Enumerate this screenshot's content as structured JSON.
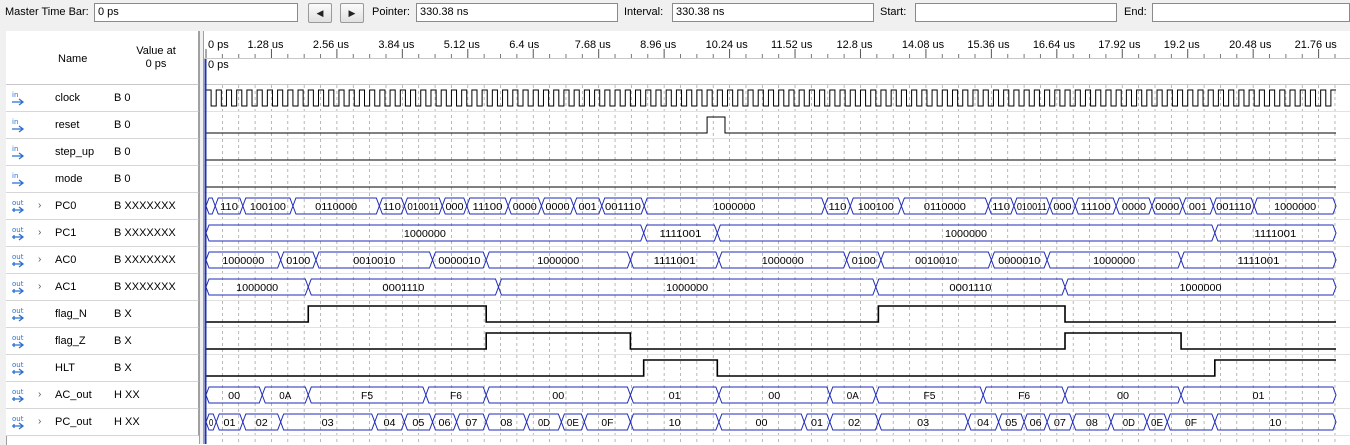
{
  "toolbar": {
    "master_label": "Master Time Bar:",
    "master_value": "0 ps",
    "pointer_label": "Pointer:",
    "pointer_value": "330.38 ns",
    "interval_label": "Interval:",
    "interval_value": "330.38 ns",
    "start_label": "Start:",
    "start_value": "",
    "end_label": "End:",
    "end_value": "",
    "prev_icon": "triangle-left-icon",
    "next_icon": "triangle-right-icon"
  },
  "header": {
    "name_label": "Name",
    "value_label_1": "Value at",
    "value_label_2": "0 ps"
  },
  "ruler": {
    "ticks": [
      "0 ps",
      "1.28 us",
      "2.56 us",
      "3.84 us",
      "5.12 us",
      "6.4 us",
      "7.68 us",
      "8.96 us",
      "10.24 us",
      "11.52 us",
      "12.8 us",
      "14.08 us",
      "15.36 us",
      "16.64 us",
      "17.92 us",
      "19.2 us",
      "20.48 us",
      "21.76 us"
    ],
    "cursor_label": "0 ps"
  },
  "signals": [
    {
      "name": "clock",
      "value": "B 0",
      "kind": "in",
      "expandable": false
    },
    {
      "name": "reset",
      "value": "B 0",
      "kind": "in",
      "expandable": false
    },
    {
      "name": "step_up",
      "value": "B 0",
      "kind": "in",
      "expandable": false
    },
    {
      "name": "mode",
      "value": "B 0",
      "kind": "in",
      "expandable": false
    },
    {
      "name": "PC0",
      "value": "B XXXXXXX",
      "kind": "out",
      "expandable": true
    },
    {
      "name": "PC1",
      "value": "B XXXXXXX",
      "kind": "out",
      "expandable": true
    },
    {
      "name": "AC0",
      "value": "B XXXXXXX",
      "kind": "out",
      "expandable": true
    },
    {
      "name": "AC1",
      "value": "B XXXXXXX",
      "kind": "out",
      "expandable": true
    },
    {
      "name": "flag_N",
      "value": "B X",
      "kind": "out",
      "expandable": false
    },
    {
      "name": "flag_Z",
      "value": "B X",
      "kind": "out",
      "expandable": false
    },
    {
      "name": "HLT",
      "value": "B X",
      "kind": "out",
      "expandable": false
    },
    {
      "name": "AC_out",
      "value": "H XX",
      "kind": "out",
      "expandable": true
    },
    {
      "name": "PC_out",
      "value": "H XX",
      "kind": "out",
      "expandable": true
    }
  ],
  "waveforms": {
    "time_range_us": [
      0,
      22.1
    ],
    "clock_period_us": 0.2,
    "reset_pulse_us": [
      9.8,
      10.15
    ],
    "PC0": {
      "segments": [
        {
          "t0": 0.0,
          "t1": 0.18,
          "label": ""
        },
        {
          "t0": 0.18,
          "t1": 0.72,
          "label": "110"
        },
        {
          "t0": 0.72,
          "t1": 1.7,
          "label": "100100"
        },
        {
          "t0": 1.7,
          "t1": 3.39,
          "label": "0110000"
        },
        {
          "t0": 3.39,
          "t1": 3.88,
          "label": "110"
        },
        {
          "t0": 3.88,
          "t1": 4.62,
          "label": "010011"
        },
        {
          "t0": 4.62,
          "t1": 5.1,
          "label": "000"
        },
        {
          "t0": 5.1,
          "t1": 5.91,
          "label": "11100"
        },
        {
          "t0": 5.91,
          "t1": 6.56,
          "label": "0000"
        },
        {
          "t0": 6.56,
          "t1": 7.19,
          "label": "0000"
        },
        {
          "t0": 7.19,
          "t1": 7.74,
          "label": "001"
        },
        {
          "t0": 7.74,
          "t1": 8.57,
          "label": "001110"
        },
        {
          "t0": 8.57,
          "t1": 12.1,
          "label": "1000000"
        },
        {
          "t0": 12.1,
          "t1": 12.6,
          "label": "110"
        },
        {
          "t0": 12.6,
          "t1": 13.6,
          "label": "100100"
        },
        {
          "t0": 13.6,
          "t1": 15.3,
          "label": "0110000"
        },
        {
          "t0": 15.3,
          "t1": 15.8,
          "label": "110"
        },
        {
          "t0": 15.8,
          "t1": 16.5,
          "label": "010011"
        },
        {
          "t0": 16.5,
          "t1": 17.0,
          "label": "000"
        },
        {
          "t0": 17.0,
          "t1": 17.8,
          "label": "11100"
        },
        {
          "t0": 17.8,
          "t1": 18.5,
          "label": "0000"
        },
        {
          "t0": 18.5,
          "t1": 19.1,
          "label": "0000"
        },
        {
          "t0": 19.1,
          "t1": 19.7,
          "label": "001"
        },
        {
          "t0": 19.7,
          "t1": 20.5,
          "label": "001110"
        },
        {
          "t0": 20.5,
          "t1": 22.1,
          "label": "1000000"
        }
      ]
    },
    "PC1": {
      "segments": [
        {
          "t0": 0.0,
          "t1": 8.56,
          "label": "1000000"
        },
        {
          "t0": 8.56,
          "t1": 10.0,
          "label": "1111001"
        },
        {
          "t0": 10.0,
          "t1": 19.73,
          "label": "1000000"
        },
        {
          "t0": 19.73,
          "t1": 22.1,
          "label": "1111001"
        }
      ]
    },
    "AC0": {
      "segments": [
        {
          "t0": 0.0,
          "t1": 1.46,
          "label": "1000000"
        },
        {
          "t0": 1.46,
          "t1": 2.15,
          "label": "0100"
        },
        {
          "t0": 2.15,
          "t1": 4.43,
          "label": "0010010"
        },
        {
          "t0": 4.43,
          "t1": 5.48,
          "label": "0000010"
        },
        {
          "t0": 5.48,
          "t1": 8.3,
          "label": "1000000"
        },
        {
          "t0": 8.3,
          "t1": 10.03,
          "label": "1111001"
        },
        {
          "t0": 10.03,
          "t1": 12.53,
          "label": "1000000"
        },
        {
          "t0": 12.53,
          "t1": 13.2,
          "label": "0100"
        },
        {
          "t0": 13.2,
          "t1": 15.36,
          "label": "0010010"
        },
        {
          "t0": 15.36,
          "t1": 16.45,
          "label": "0000010"
        },
        {
          "t0": 16.45,
          "t1": 19.07,
          "label": "1000000"
        },
        {
          "t0": 19.07,
          "t1": 22.1,
          "label": "1111001"
        }
      ]
    },
    "AC1": {
      "segments": [
        {
          "t0": 0.0,
          "t1": 2.0,
          "label": "1000000"
        },
        {
          "t0": 2.0,
          "t1": 5.72,
          "label": "0001110"
        },
        {
          "t0": 5.72,
          "t1": 13.1,
          "label": "1000000"
        },
        {
          "t0": 13.1,
          "t1": 16.8,
          "label": "0001110"
        },
        {
          "t0": 16.8,
          "t1": 22.1,
          "label": "1000000"
        }
      ]
    },
    "flag_N": {
      "initial": 0,
      "edges_us": [
        2.0,
        5.48,
        13.15,
        16.8
      ]
    },
    "flag_Z": {
      "initial": 0,
      "edges_us": [
        5.48,
        8.3,
        16.8,
        19.07
      ]
    },
    "HLT": {
      "initial": 0,
      "edges_us": [
        8.56,
        10.0,
        19.73
      ]
    },
    "AC_out": {
      "segments": [
        {
          "t0": 0.0,
          "t1": 1.1,
          "label": "00"
        },
        {
          "t0": 1.1,
          "t1": 2.0,
          "label": "0A"
        },
        {
          "t0": 2.0,
          "t1": 4.3,
          "label": "F5"
        },
        {
          "t0": 4.3,
          "t1": 5.48,
          "label": "F6"
        },
        {
          "t0": 5.48,
          "t1": 8.3,
          "label": "00"
        },
        {
          "t0": 8.3,
          "t1": 10.03,
          "label": "01"
        },
        {
          "t0": 10.03,
          "t1": 12.2,
          "label": "00"
        },
        {
          "t0": 12.2,
          "t1": 13.1,
          "label": "0A"
        },
        {
          "t0": 13.1,
          "t1": 15.2,
          "label": "F5"
        },
        {
          "t0": 15.2,
          "t1": 16.8,
          "label": "F6"
        },
        {
          "t0": 16.8,
          "t1": 19.07,
          "label": "00"
        },
        {
          "t0": 19.07,
          "t1": 22.1,
          "label": "01"
        }
      ]
    },
    "PC_out": {
      "segments": [
        {
          "t0": 0.0,
          "t1": 0.2,
          "label": "0"
        },
        {
          "t0": 0.2,
          "t1": 0.72,
          "label": "01"
        },
        {
          "t0": 0.72,
          "t1": 1.46,
          "label": "02"
        },
        {
          "t0": 1.46,
          "t1": 3.3,
          "label": "03"
        },
        {
          "t0": 3.3,
          "t1": 3.88,
          "label": "04"
        },
        {
          "t0": 3.88,
          "t1": 4.43,
          "label": "05"
        },
        {
          "t0": 4.43,
          "t1": 4.9,
          "label": "06"
        },
        {
          "t0": 4.9,
          "t1": 5.48,
          "label": "07"
        },
        {
          "t0": 5.48,
          "t1": 6.27,
          "label": "08"
        },
        {
          "t0": 6.27,
          "t1": 6.95,
          "label": "0D"
        },
        {
          "t0": 6.95,
          "t1": 7.4,
          "label": "0E"
        },
        {
          "t0": 7.4,
          "t1": 8.3,
          "label": "0F"
        },
        {
          "t0": 8.3,
          "t1": 10.03,
          "label": "10"
        },
        {
          "t0": 10.03,
          "t1": 11.7,
          "label": "00"
        },
        {
          "t0": 11.7,
          "t1": 12.2,
          "label": "01"
        },
        {
          "t0": 12.2,
          "t1": 13.15,
          "label": "02"
        },
        {
          "t0": 13.15,
          "t1": 14.9,
          "label": "03"
        },
        {
          "t0": 14.9,
          "t1": 15.5,
          "label": "04"
        },
        {
          "t0": 15.5,
          "t1": 16.0,
          "label": "05"
        },
        {
          "t0": 16.0,
          "t1": 16.45,
          "label": "06"
        },
        {
          "t0": 16.45,
          "t1": 16.95,
          "label": "07"
        },
        {
          "t0": 16.95,
          "t1": 17.7,
          "label": "08"
        },
        {
          "t0": 17.7,
          "t1": 18.4,
          "label": "0D"
        },
        {
          "t0": 18.4,
          "t1": 18.8,
          "label": "0E"
        },
        {
          "t0": 18.8,
          "t1": 19.73,
          "label": "0F"
        },
        {
          "t0": 19.73,
          "t1": 22.1,
          "label": "10"
        }
      ]
    }
  },
  "colors": {
    "bus": "#000000",
    "bus_edge": "#1f2bb8",
    "grid": "#9a9a9a",
    "cursor": "#2233aa",
    "in_icon": "#2b6fd1",
    "out_icon": "#2b6fd1"
  }
}
